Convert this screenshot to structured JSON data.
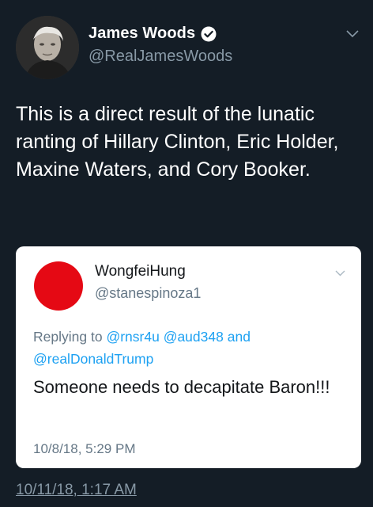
{
  "tweet": {
    "author": {
      "display_name": "James Woods",
      "handle": "@RealJamesWoods",
      "verified": true
    },
    "text": "This is a direct result of the lunatic ranting of Hillary Clinton, Eric Holder, Maxine Waters, and Cory Booker.",
    "timestamp": "10/11/18, 1:17 AM",
    "quoted": {
      "author": {
        "display_name": "WongfeiHung",
        "handle": "@stanespinoza1",
        "avatar_color": "#e50914"
      },
      "reply": {
        "prefix": "Replying to",
        "mention_1": "@rnsr4u",
        "mention_2": "@aud348",
        "conjunction": "and",
        "mention_3": "@realDonaldTrump"
      },
      "text": "Someone needs to decapitate Baron!!!",
      "timestamp": "10/8/18, 5:29 PM"
    }
  },
  "colors": {
    "background": "#141d26",
    "primary_text": "#ffffff",
    "secondary_text": "#8899a6",
    "mention": "#1da1f2"
  },
  "icons": {
    "verified": "verified-badge-icon",
    "menu": "chevron-down-icon"
  }
}
